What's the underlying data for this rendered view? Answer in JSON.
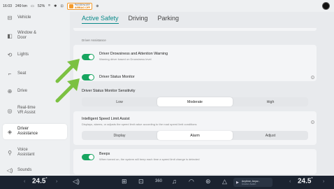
{
  "status_bar": {
    "time": "16:03",
    "range": "249 km",
    "battery": "52%",
    "airbag_line1": "PASSENGER",
    "airbag_line2": "AIRBAG OFF"
  },
  "sidebar": {
    "items": [
      {
        "icon": "vehicle-icon",
        "label": "Vehicle"
      },
      {
        "icon": "window-door-icon",
        "label": "Window & Door"
      },
      {
        "icon": "lights-icon",
        "label": "Lights"
      },
      {
        "icon": "seat-icon",
        "label": "Seat"
      },
      {
        "icon": "steering-wheel-icon",
        "label": "Drive"
      },
      {
        "icon": "real-time-vr-icon",
        "label": "Real-time VR Assist"
      },
      {
        "icon": "driver-assistance-icon",
        "label": "Driver Assistance"
      },
      {
        "icon": "voice-assistant-icon",
        "label": "Voice Assistant"
      },
      {
        "icon": "sounds-icon",
        "label": "Sounds"
      }
    ],
    "active": "Driver Assistance"
  },
  "main": {
    "tabs": [
      {
        "label": "Active Safety"
      },
      {
        "label": "Driving"
      },
      {
        "label": "Parking"
      }
    ],
    "section_label": "Driver Assistance",
    "drowsiness": {
      "title": "Driver Drowsiness and Attention Warning",
      "subtitle": "Warning driver based on Drowsiness level"
    },
    "status_monitor": {
      "title": "Driver Status Monitor"
    },
    "sensitivity": {
      "title": "Driver Status Monitor Sensitivity",
      "options": [
        "Low",
        "Moderate",
        "High"
      ],
      "selected": "Moderate"
    },
    "speed_limit": {
      "title": "Intelligent Speed Limit Assist",
      "subtitle": "Displays, alarms, or adjusts the speed limit value according to the road speed limit conditions",
      "options": [
        "Display",
        "Alarm",
        "Adjust"
      ],
      "selected": "Alarm"
    },
    "beeps": {
      "title": "Beeps",
      "subtitle": "When turned on, the system will beep each time a speed limit change is detected"
    }
  },
  "dock": {
    "left_temp": "24.5",
    "right_temp": "24.5",
    "temp_unit": "°",
    "media_title": "Anytime, Anyw...",
    "media_sub": "Doctor Avam"
  },
  "colors": {
    "accent": "#0a8a8a",
    "toggle_on": "#17a560",
    "arrow": "#7cc142",
    "dock_bg": "#1b2330"
  }
}
